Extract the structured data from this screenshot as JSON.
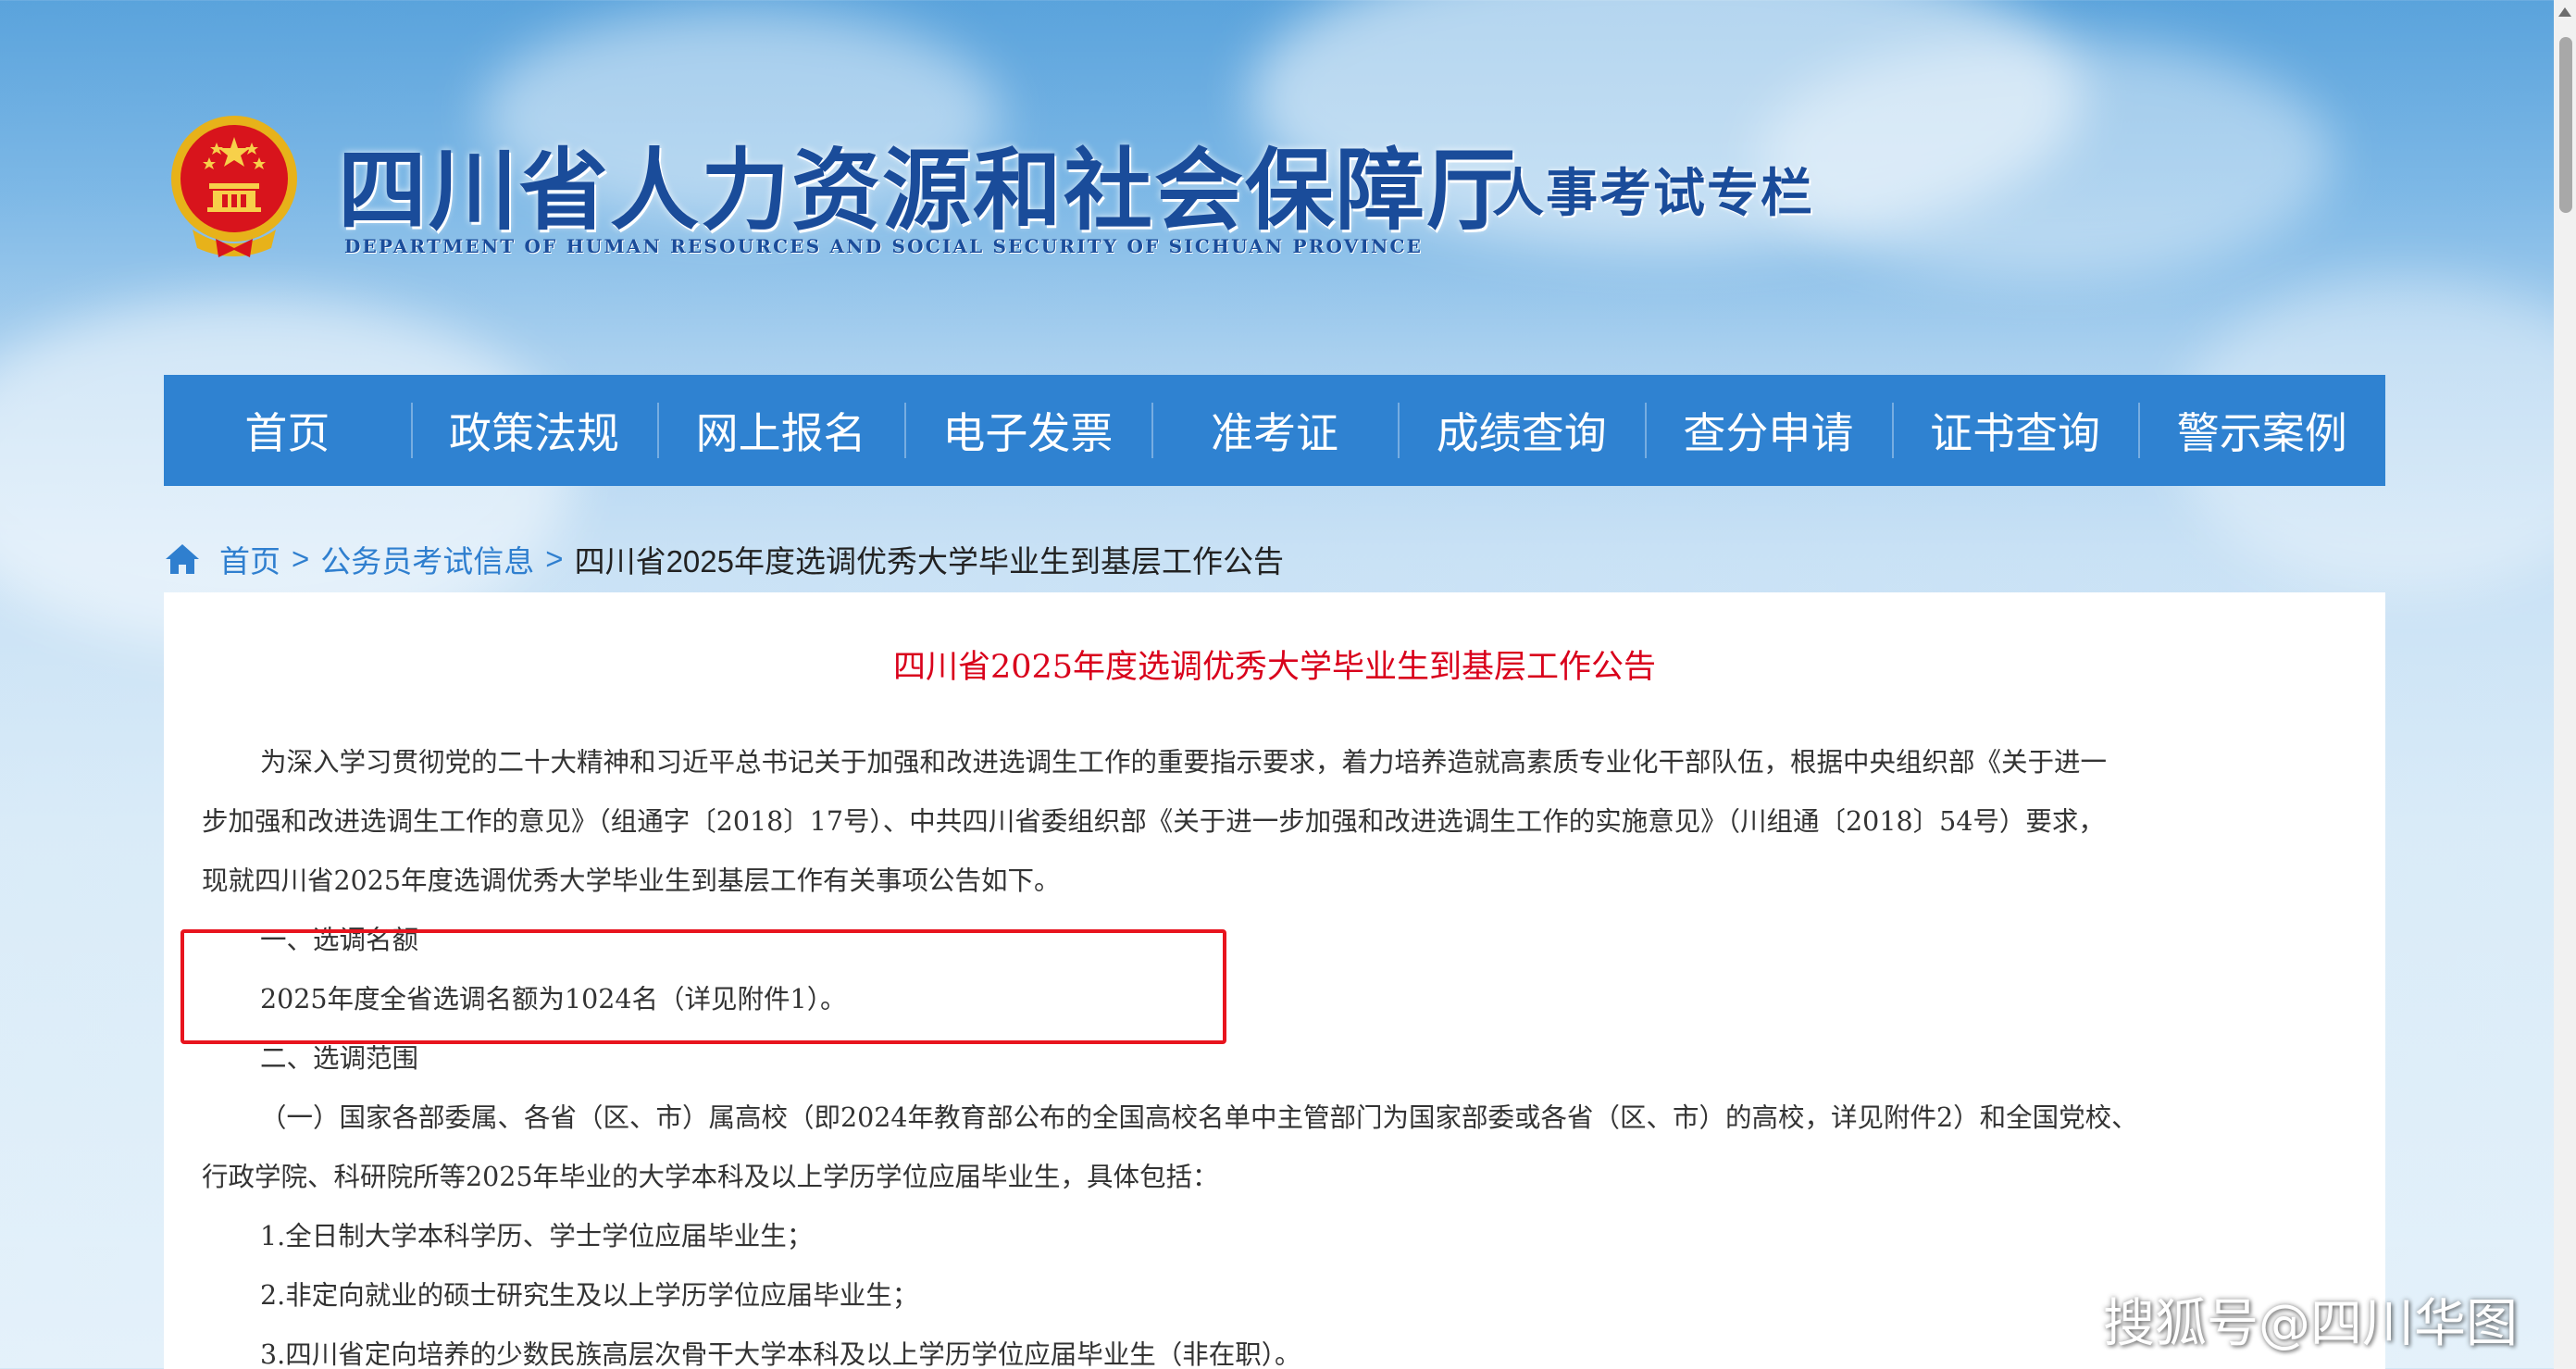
{
  "header": {
    "site_title": "四川省人力资源和社会保障厅",
    "site_subtitle": "DEPARTMENT OF HUMAN RESOURCES AND SOCIAL SECURITY OF SICHUAN PROVINCE",
    "column_title": "人事考试专栏",
    "emblem_icon": "national-emblem-icon"
  },
  "nav": {
    "items": [
      {
        "label": "首页"
      },
      {
        "label": "政策法规"
      },
      {
        "label": "网上报名"
      },
      {
        "label": "电子发票"
      },
      {
        "label": "准考证"
      },
      {
        "label": "成绩查询"
      },
      {
        "label": "查分申请"
      },
      {
        "label": "证书查询"
      },
      {
        "label": "警示案例"
      }
    ],
    "background_color": "#2f82d1"
  },
  "breadcrumb": {
    "home_icon": "home-icon",
    "home": "首页",
    "separator": ">",
    "category": "公务员考试信息",
    "current": "四川省2025年度选调优秀大学毕业生到基层工作公告"
  },
  "article": {
    "title": "四川省2025年度选调优秀大学毕业生到基层工作公告",
    "title_color": "#d9001b",
    "lines": [
      "为深入学习贯彻党的二十大精神和习近平总书记关于加强和改进选调生工作的重要指示要求，着力培养造就高素质专业化干部队伍，根据中央组织部《关于进一",
      "步加强和改进选调生工作的意见》（组通字〔2018〕17号）、中共四川省委组织部《关于进一步加强和改进选调生工作的实施意见》（川组通〔2018〕54号）要求，",
      "现就四川省2025年度选调优秀大学毕业生到基层工作有关事项公告如下。",
      "一、选调名额",
      "2025年度全省选调名额为1024名（详见附件1）。",
      "二、选调范围",
      "（一）国家各部委属、各省（区、市）属高校（即2024年教育部公布的全国高校名单中主管部门为国家部委或各省（区、市）的高校，详见附件2）和全国党校、",
      "行政学院、科研院所等2025年毕业的大学本科及以上学历学位应届毕业生，具体包括：",
      "1.全日制大学本科学历、学士学位应届毕业生；",
      "2.非定向就业的硕士研究生及以上学历学位应届毕业生；",
      "3.四川省定向培养的少数民族高层次骨干大学本科及以上学历学位应届毕业生（非在职）。"
    ]
  },
  "watermark": "搜狐号@四川华图"
}
